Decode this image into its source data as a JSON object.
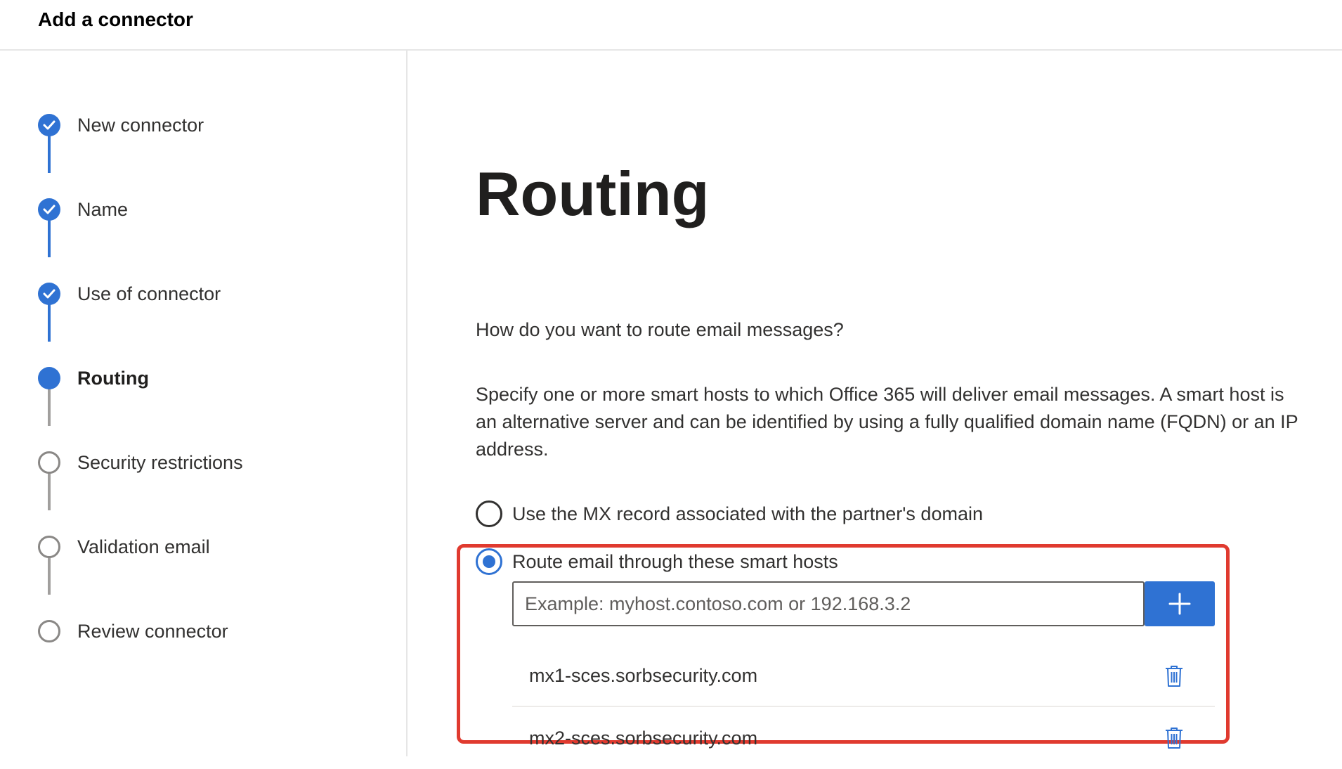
{
  "app": {
    "title": "Add a connector"
  },
  "colors": {
    "accent": "#2f72d3",
    "highlight": "#e03a2f",
    "pending": "#8a8886"
  },
  "steps": [
    {
      "label": "New connector",
      "state": "completed",
      "icon": "checkmark-icon"
    },
    {
      "label": "Name",
      "state": "completed",
      "icon": "checkmark-icon"
    },
    {
      "label": "Use of connector",
      "state": "completed",
      "icon": "checkmark-icon"
    },
    {
      "label": "Routing",
      "state": "current",
      "icon": "filled-circle-icon"
    },
    {
      "label": "Security restrictions",
      "state": "pending",
      "icon": "empty-circle-icon"
    },
    {
      "label": "Validation email",
      "state": "pending",
      "icon": "empty-circle-icon"
    },
    {
      "label": "Review connector",
      "state": "pending",
      "icon": "empty-circle-icon"
    }
  ],
  "main": {
    "title": "Routing",
    "question": "How do you want to route email messages?",
    "description": "Specify one or more smart hosts to which Office 365 will deliver email messages. A smart host is an alternative server and can be identified by using a fully qualified domain name (FQDN) or an IP address.",
    "options": [
      {
        "label": "Use the MX record associated with the partner's domain",
        "selected": false
      },
      {
        "label": "Route email through these smart hosts",
        "selected": true
      }
    ],
    "host_input": {
      "placeholder": "Example: myhost.contoso.com or 192.168.3.2",
      "value": ""
    },
    "add_button": {
      "icon": "plus-icon"
    },
    "smart_hosts": [
      {
        "name": "mx1-sces.sorbsecurity.com",
        "delete_icon": "trash-icon"
      },
      {
        "name": "mx2-sces.sorbsecurity.com",
        "delete_icon": "trash-icon"
      }
    ]
  }
}
